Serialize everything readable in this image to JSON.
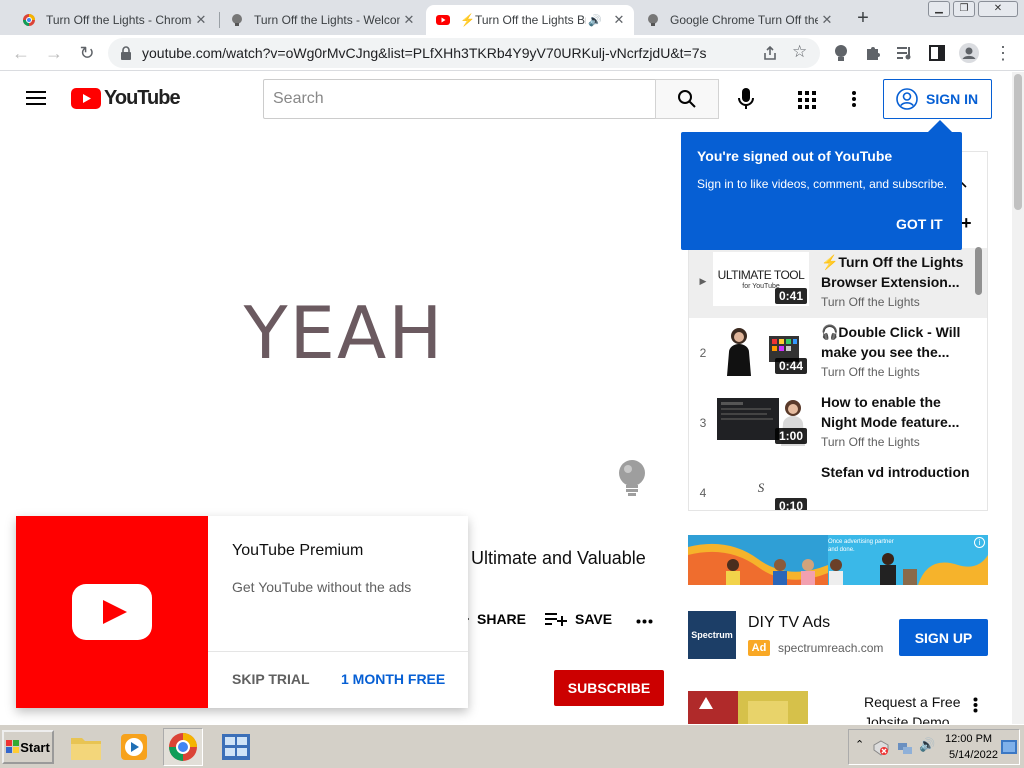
{
  "browser": {
    "tabs": [
      {
        "title": "Turn Off the Lights - Chrome",
        "favicon": "chrome-webstore-icon",
        "active": false
      },
      {
        "title": "Turn Off the Lights - Welcome",
        "favicon": "lightbulb-icon",
        "active": false
      },
      {
        "title": "⚡Turn Off the Lights Bro",
        "favicon": "youtube-icon",
        "active": true,
        "audio": true
      },
      {
        "title": "Google Chrome Turn Off the",
        "favicon": "lightbulb-icon",
        "active": false
      }
    ],
    "url": "youtube.com/watch?v=oWg0rMvCJng&list=PLfXHh3TKRb4Y9yV70URKulj-vNcrfzjdU&t=7s"
  },
  "youtube": {
    "logo_text": "YouTube",
    "search_placeholder": "Search",
    "signin_label": "SIGN IN",
    "brand_color": "#ff0000",
    "accent_blue": "#065fd4"
  },
  "player": {
    "overlay_text": "YEAH"
  },
  "tooltip": {
    "title": "You're signed out of YouTube",
    "body": "Sign in to like videos, comment, and subscribe.",
    "button": "GOT IT"
  },
  "playlist": {
    "items": [
      {
        "index": "▶",
        "title": "⚡Turn Off the Lights Browser Extension...",
        "channel": "Turn Off the Lights",
        "duration": "0:41",
        "thumb_text": "ULTIMATE TOOL",
        "thumb_sub": "for YouTube",
        "current": true
      },
      {
        "index": "2",
        "title": "🎧Double Click - Will make you see the...",
        "channel": "Turn Off the Lights",
        "duration": "0:44"
      },
      {
        "index": "3",
        "title": "How to enable the Night Mode feature...",
        "channel": "Turn Off the Lights",
        "duration": "1:00"
      },
      {
        "index": "4",
        "title": "Stefan vd introduction",
        "channel": "",
        "duration": "0:10",
        "thumb_text": "S"
      }
    ]
  },
  "video": {
    "title_fragment": "Ultimate and Valuable",
    "share_label": "SHARE",
    "save_label": "SAVE",
    "subscribe_label": "SUBSCRIBE"
  },
  "premium": {
    "title": "YouTube Premium",
    "subtitle": "Get YouTube without the ads",
    "skip_label": "SKIP TRIAL",
    "month_label": "1 MONTH FREE"
  },
  "ads": {
    "banner_text": "Once advertising partner and done.",
    "diy": {
      "title": "DIY TV Ads",
      "badge": "Ad",
      "domain": "spectrumreach.com",
      "logo_text": "Spectrum",
      "cta": "SIGN UP"
    },
    "next_title": "Request a Free Jobsite Demo"
  },
  "taskbar": {
    "start_label": "Start",
    "time": "12:00 PM",
    "date": "5/14/2022"
  }
}
